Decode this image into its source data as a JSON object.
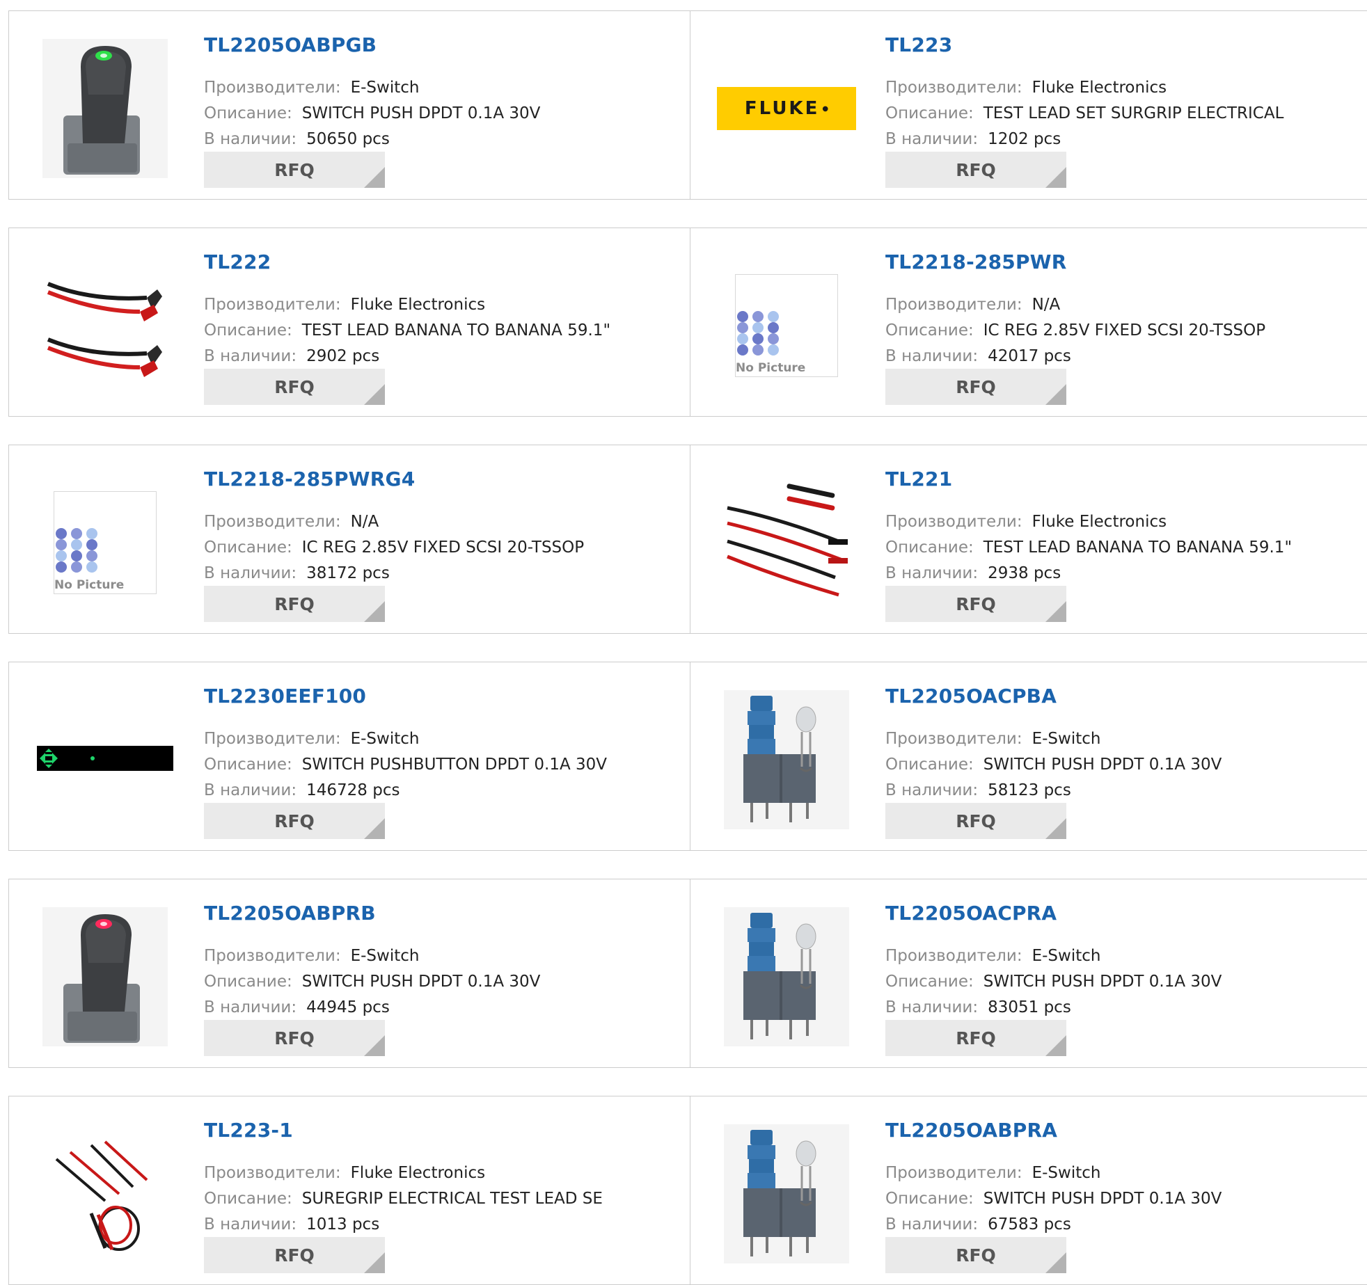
{
  "labels": {
    "manufacturer": "Производители:",
    "description": "Описание:",
    "stock": "В наличии:",
    "rfq": "RFQ",
    "no_picture": "No Picture",
    "fluke_logo": "FLUKE"
  },
  "colors": {
    "part_link": "#1b63ad",
    "label_gray": "#8a8a8a",
    "value_dark": "#222222",
    "rfq_bg": "#eaeaea",
    "border": "#cccccc",
    "fluke_yellow": "#ffcc00"
  },
  "products": [
    {
      "part": "TL2205OABPGB",
      "manufacturer": "E-Switch",
      "description": "SWITCH PUSH DPDT 0.1A 30V",
      "stock": "50650 pcs",
      "image": "rocker-switch-green-icon"
    },
    {
      "part": "TL223",
      "manufacturer": "Fluke Electronics",
      "description": "TEST LEAD SET SURGRIP ELECTRICAL",
      "stock": "1202 pcs",
      "image": "fluke-logo"
    },
    {
      "part": "TL222",
      "manufacturer": "Fluke Electronics",
      "description": "TEST LEAD BANANA TO BANANA 59.1\"",
      "stock": "2902 pcs",
      "image": "test-leads-right-angle-icon"
    },
    {
      "part": "TL2218-285PWR",
      "manufacturer": "N/A",
      "description": "IC REG 2.85V FIXED SCSI 20-TSSOP",
      "stock": "42017 pcs",
      "image": "no-picture-icon"
    },
    {
      "part": "TL2218-285PWRG4",
      "manufacturer": "N/A",
      "description": "IC REG 2.85V FIXED SCSI 20-TSSOP",
      "stock": "38172 pcs",
      "image": "no-picture-icon"
    },
    {
      "part": "TL221",
      "manufacturer": "Fluke Electronics",
      "description": "TEST LEAD BANANA TO BANANA 59.1\"",
      "stock": "2938 pcs",
      "image": "test-leads-straight-icon"
    },
    {
      "part": "TL2230EEF100",
      "manufacturer": "E-Switch",
      "description": "SWITCH PUSHBUTTON DPDT 0.1A 30V",
      "stock": "146728 pcs",
      "image": "led-strip-icon"
    },
    {
      "part": "TL2205OACPBA",
      "manufacturer": "E-Switch",
      "description": "SWITCH PUSH DPDT 0.1A 30V",
      "stock": "58123 pcs",
      "image": "pushbutton-switch-blue-icon"
    },
    {
      "part": "TL2205OABPRB",
      "manufacturer": "E-Switch",
      "description": "SWITCH PUSH DPDT 0.1A 30V",
      "stock": "44945 pcs",
      "image": "rocker-switch-red-icon"
    },
    {
      "part": "TL2205OACPRA",
      "manufacturer": "E-Switch",
      "description": "SWITCH PUSH DPDT 0.1A 30V",
      "stock": "83051 pcs",
      "image": "pushbutton-switch-blue-icon"
    },
    {
      "part": "TL223-1",
      "manufacturer": "Fluke Electronics",
      "description": "SUREGRIP ELECTRICAL TEST LEAD SE",
      "stock": "1013 pcs",
      "image": "test-lead-kit-icon"
    },
    {
      "part": "TL2205OABPRA",
      "manufacturer": "E-Switch",
      "description": "SWITCH PUSH DPDT 0.1A 30V",
      "stock": "67583 pcs",
      "image": "pushbutton-switch-blue-icon"
    }
  ]
}
